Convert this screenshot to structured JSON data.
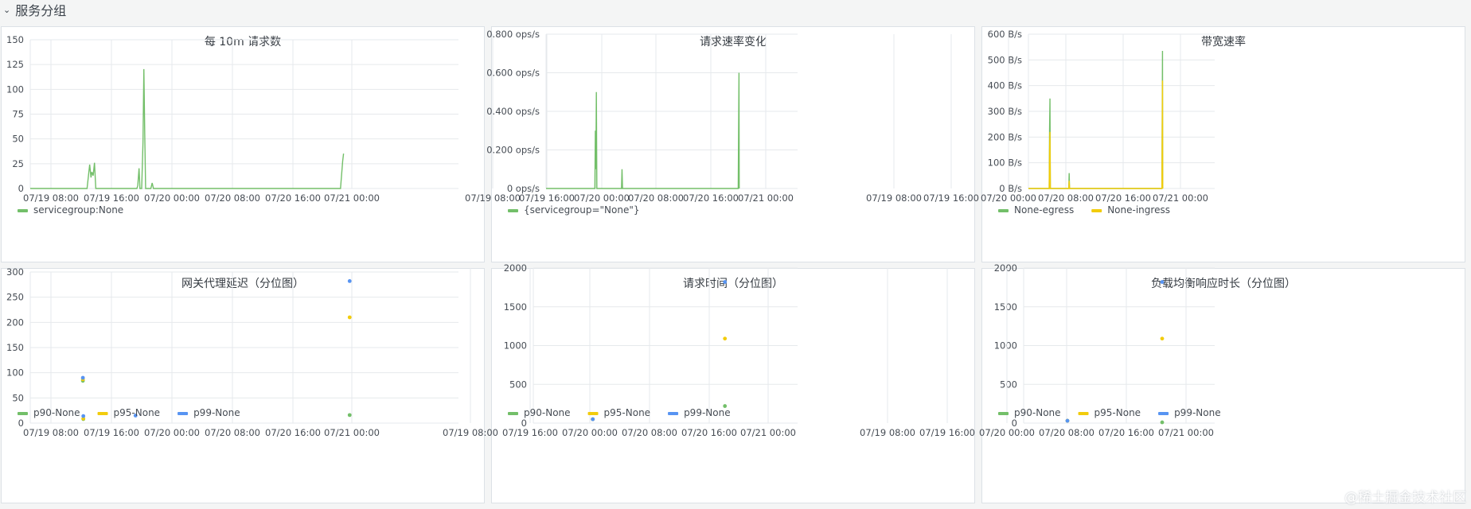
{
  "section": {
    "title": "服务分组",
    "chevron_icon": "chevron-down-icon"
  },
  "colors": {
    "green": "#73bf69",
    "yellow": "#f2cc0c",
    "blue": "#5794f2",
    "grid": "#e6e9ec"
  },
  "x_ticks": [
    "07/19 08:00",
    "07/19 16:00",
    "07/20 00:00",
    "07/20 08:00",
    "07/20 16:00",
    "07/21 00:00"
  ],
  "watermark": "@稀土掘金技术社区",
  "chart_data": [
    {
      "type": "line",
      "title": "每 10m 请求数",
      "x_range": [
        "07/19 05:00",
        "07/21 06:00"
      ],
      "ylim": [
        0,
        162
      ],
      "y_ticks": [
        "0",
        "25",
        "50",
        "75",
        "100",
        "125",
        "150"
      ],
      "series": [
        {
          "name": "servicegroup:None",
          "color": "#73bf69",
          "points": [
            [
              0,
              0
            ],
            [
              6.5,
              0
            ],
            [
              6.8,
              26
            ],
            [
              6.95,
              12
            ],
            [
              7.05,
              18
            ],
            [
              7.2,
              14
            ],
            [
              7.35,
              28
            ],
            [
              7.5,
              0
            ],
            [
              12.2,
              0
            ],
            [
              12.3,
              3
            ],
            [
              12.45,
              22
            ],
            [
              12.55,
              0
            ],
            [
              12.75,
              0
            ],
            [
              12.9,
              50
            ],
            [
              13.0,
              130
            ],
            [
              13.1,
              60
            ],
            [
              13.2,
              0
            ],
            [
              13.8,
              0
            ],
            [
              13.95,
              6
            ],
            [
              14.1,
              0
            ],
            [
              35.5,
              0
            ],
            [
              35.75,
              30
            ],
            [
              35.85,
              38
            ]
          ]
        }
      ],
      "legend": [
        "servicegroup:None"
      ]
    },
    {
      "type": "area",
      "title": "请求速率变化",
      "x_range": [
        "07/19 05:00",
        "07/21 07:00"
      ],
      "ylim": [
        0,
        0.8
      ],
      "y_ticks": [
        "0 ops/s",
        "0.200 ops/s",
        "0.400 ops/s",
        "0.600 ops/s",
        "0.800 ops/s"
      ],
      "series": [
        {
          "name": "{servicegroup=\"None\"}",
          "color": "#73bf69",
          "points": [
            [
              0,
              0
            ],
            [
              9.7,
              0
            ],
            [
              9.8,
              0.3
            ],
            [
              9.9,
              0.1
            ],
            [
              10.0,
              0.5
            ],
            [
              10.1,
              0
            ],
            [
              15.0,
              0
            ],
            [
              15.1,
              0.1
            ],
            [
              15.2,
              0
            ],
            [
              38.2,
              0
            ],
            [
              38.35,
              0.6
            ],
            [
              38.4,
              0
            ]
          ]
        }
      ],
      "legend": [
        "{servicegroup=\"None\"}"
      ]
    },
    {
      "type": "area",
      "title": "带宽速率",
      "x_range": [
        "07/19 05:00",
        "07/21 05:00"
      ],
      "ylim": [
        0,
        600
      ],
      "y_ticks": [
        "0 B/s",
        "100 B/s",
        "200 B/s",
        "300 B/s",
        "400 B/s",
        "500 B/s",
        "600 B/s"
      ],
      "series": [
        {
          "name": "None-egress",
          "color": "#73bf69",
          "points": [
            [
              0,
              0
            ],
            [
              5.35,
              0
            ],
            [
              5.45,
              230
            ],
            [
              5.55,
              350
            ],
            [
              5.65,
              0
            ],
            [
              10.4,
              0
            ],
            [
              10.5,
              60
            ],
            [
              10.6,
              0
            ],
            [
              34.4,
              0
            ],
            [
              34.55,
              535
            ],
            [
              34.6,
              0
            ]
          ]
        },
        {
          "name": "None-ingress",
          "color": "#f2cc0c",
          "points": [
            [
              0,
              0
            ],
            [
              5.35,
              0
            ],
            [
              5.45,
              150
            ],
            [
              5.55,
              220
            ],
            [
              5.65,
              0
            ],
            [
              10.4,
              0
            ],
            [
              10.5,
              30
            ],
            [
              10.6,
              0
            ],
            [
              34.4,
              0
            ],
            [
              34.55,
              420
            ],
            [
              34.6,
              0
            ]
          ]
        }
      ],
      "legend": [
        "None-egress",
        "None-ingress"
      ]
    },
    {
      "type": "scatter",
      "title": "网关代理延迟（分位图）",
      "x_range": [
        "07/19 05:00",
        "07/21 05:00"
      ],
      "ylim": [
        0,
        300
      ],
      "y_ticks": [
        "0",
        "50",
        "100",
        "150",
        "200",
        "250",
        "300"
      ],
      "series": [
        {
          "name": "p90-None",
          "color": "#73bf69",
          "points": [
            [
              5.9,
              84
            ],
            [
              5.95,
              8
            ],
            [
              35.8,
              16
            ]
          ]
        },
        {
          "name": "p95-None",
          "color": "#f2cc0c",
          "points": [
            [
              5.9,
              87
            ],
            [
              5.95,
              9
            ],
            [
              35.8,
              210
            ]
          ]
        },
        {
          "name": "p99-None",
          "color": "#5794f2",
          "points": [
            [
              5.9,
              90
            ],
            [
              5.95,
              14
            ],
            [
              11.8,
              15
            ],
            [
              35.8,
              282
            ]
          ]
        }
      ],
      "legend": [
        "p90-None",
        "p95-None",
        "p99-None"
      ]
    },
    {
      "type": "scatter",
      "title": "请求时间（分位图）",
      "x_range": [
        "07/19 05:00",
        "07/21 05:00"
      ],
      "ylim": [
        0,
        2000
      ],
      "y_ticks": [
        "0",
        "500",
        "1000",
        "1500",
        "2000"
      ],
      "series": [
        {
          "name": "p90-None",
          "color": "#73bf69",
          "points": [
            [
              10.8,
              50
            ],
            [
              34.8,
              220
            ]
          ]
        },
        {
          "name": "p95-None",
          "color": "#f2cc0c",
          "points": [
            [
              10.8,
              50
            ],
            [
              34.8,
              1090
            ]
          ]
        },
        {
          "name": "p99-None",
          "color": "#5794f2",
          "points": [
            [
              10.8,
              50
            ],
            [
              34.8,
              1820
            ]
          ]
        }
      ],
      "legend": [
        "p90-None",
        "p95-None",
        "p99-None"
      ]
    },
    {
      "type": "scatter",
      "title": "负载均衡响应时长（分位图）",
      "x_range": [
        "07/19 05:00",
        "07/21 05:00"
      ],
      "ylim": [
        0,
        2000
      ],
      "y_ticks": [
        "0",
        "500",
        "1000",
        "1500",
        "2000"
      ],
      "series": [
        {
          "name": "p90-None",
          "color": "#73bf69",
          "points": [
            [
              11.0,
              30
            ],
            [
              34.8,
              10
            ]
          ]
        },
        {
          "name": "p95-None",
          "color": "#f2cc0c",
          "points": [
            [
              11.0,
              30
            ],
            [
              34.8,
              1090
            ]
          ]
        },
        {
          "name": "p99-None",
          "color": "#5794f2",
          "points": [
            [
              11.0,
              30
            ],
            [
              34.8,
              1820
            ]
          ]
        }
      ],
      "legend": [
        "p90-None",
        "p95-None",
        "p99-None"
      ]
    }
  ]
}
